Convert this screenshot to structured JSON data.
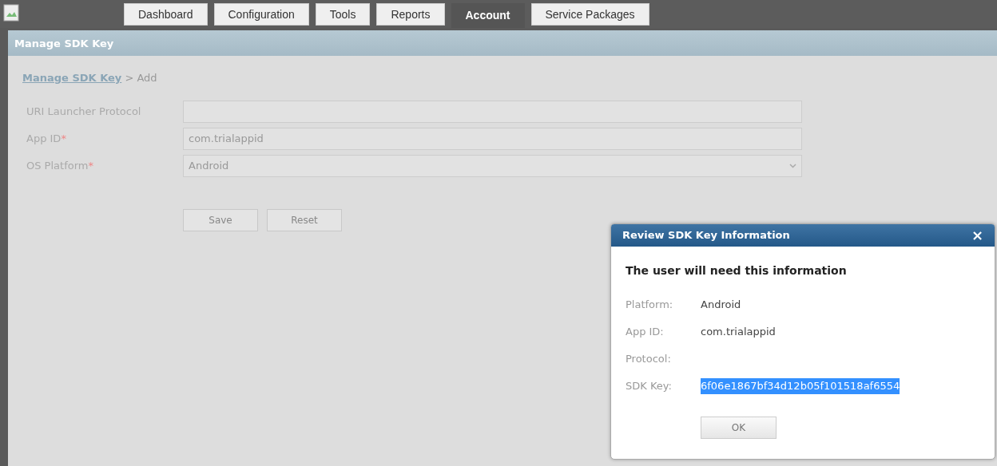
{
  "tabs": [
    {
      "label": "Dashboard",
      "selected": false
    },
    {
      "label": "Configuration",
      "selected": false
    },
    {
      "label": "Tools",
      "selected": false
    },
    {
      "label": "Reports",
      "selected": false
    },
    {
      "label": "Account",
      "selected": true
    },
    {
      "label": "Service Packages",
      "selected": false
    }
  ],
  "panel_title": "Manage SDK Key",
  "breadcrumb": {
    "link": "Manage SDK Key",
    "separator": ">",
    "current": "Add"
  },
  "required_mark": "*",
  "form": [
    {
      "label": "URI Launcher Protocol",
      "required": false,
      "kind": "text"
    },
    {
      "label": "App ID",
      "required": true,
      "kind": "text",
      "value": "com.trialappid"
    },
    {
      "label": "OS Platform",
      "required": true,
      "kind": "select",
      "value": "Android"
    }
  ],
  "buttons": [
    "Save",
    "Reset"
  ],
  "dialog": {
    "title": "Review SDK Key Information",
    "close": "×",
    "heading": "The user will need this information",
    "rows": [
      {
        "label": "Platform:",
        "value": "Android",
        "selected": false
      },
      {
        "label": "App ID:",
        "value": "com.trialappid",
        "selected": false
      },
      {
        "label": "Protocol:"
      },
      {
        "label": "SDK Key:",
        "value": "6f06e1867bf34d12b05f101518af6554",
        "selected": true
      }
    ],
    "ok": "OK"
  }
}
